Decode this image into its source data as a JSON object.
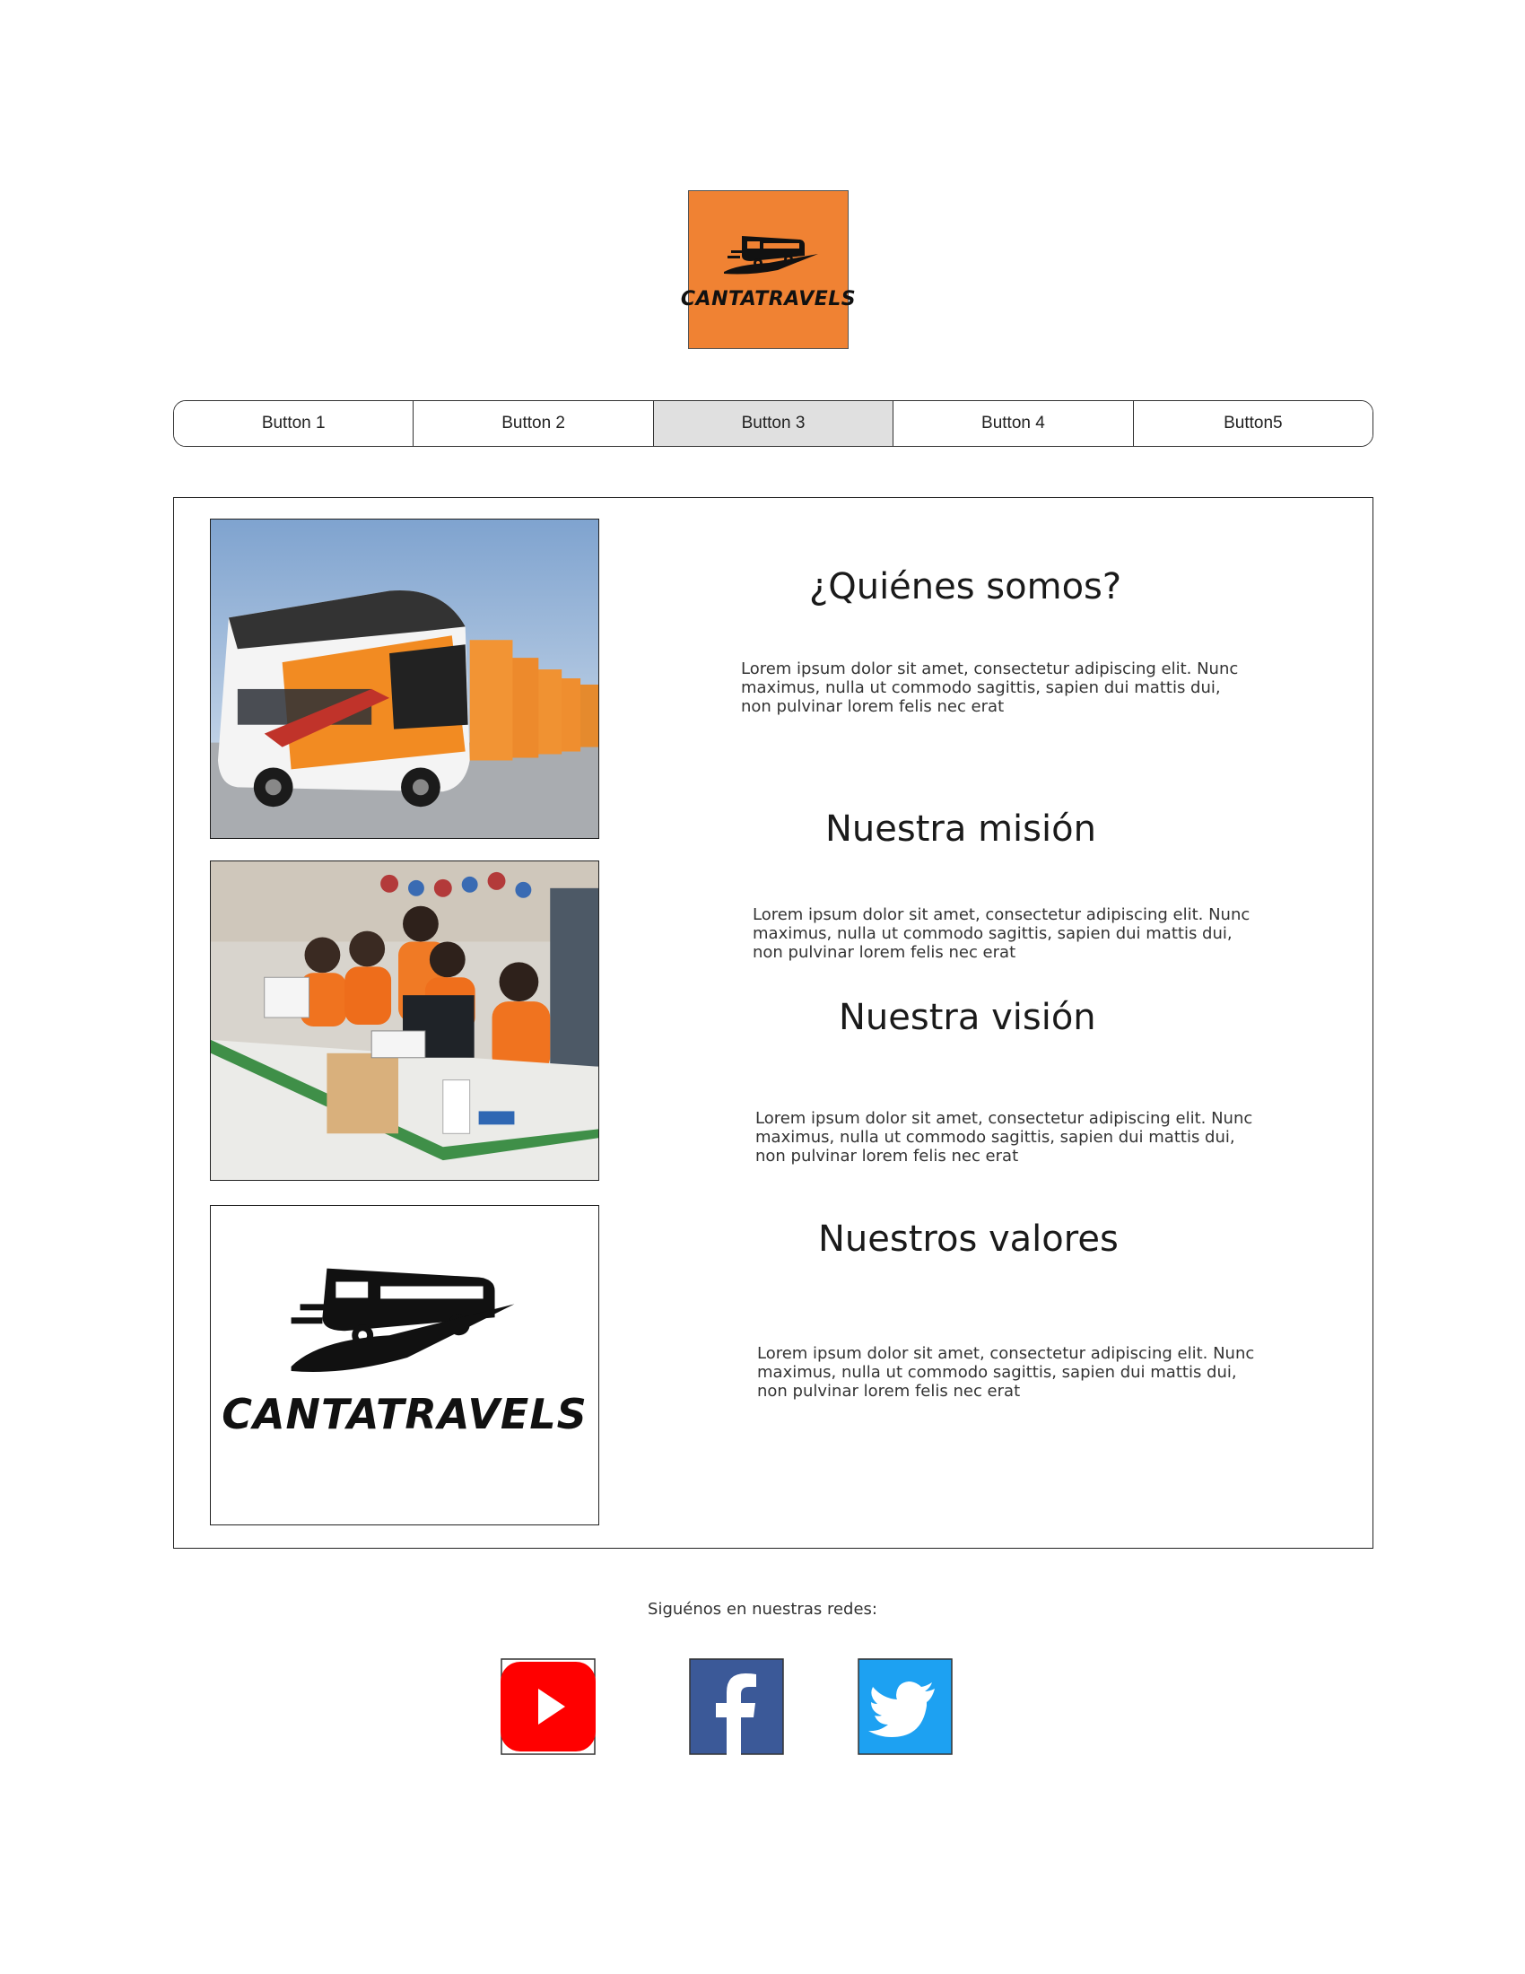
{
  "logo": {
    "text": "CANTATRAVELS",
    "background": "#f08233",
    "icon": "bus-icon"
  },
  "nav": {
    "buttons": [
      {
        "label": "Button 1"
      },
      {
        "label": "Button 2"
      },
      {
        "label": "Button 3",
        "active": true
      },
      {
        "label": "Button 4"
      },
      {
        "label": "Button5"
      }
    ]
  },
  "sections": [
    {
      "heading": "¿Quiénes somos?",
      "text": "Lorem ipsum dolor sit amet, consectetur adipiscing elit. Nunc maximus, nulla ut commodo sagittis, sapien dui mattis dui, non pulvinar lorem felis nec erat"
    },
    {
      "heading": "Nuestra misión",
      "text": "Lorem ipsum dolor sit amet, consectetur adipiscing elit. Nunc maximus, nulla ut commodo sagittis, sapien dui mattis dui, non pulvinar lorem felis nec erat"
    },
    {
      "heading": "Nuestra visión",
      "text": "Lorem ipsum dolor sit amet, consectetur adipiscing elit. Nunc maximus, nulla ut commodo sagittis, sapien dui mattis dui, non pulvinar lorem felis nec erat"
    },
    {
      "heading": "Nuestros valores",
      "text": "Lorem ipsum dolor sit amet, consectetur adipiscing elit. Nunc maximus, nulla ut commodo sagittis, sapien dui mattis dui, non pulvinar lorem felis nec erat"
    }
  ],
  "images": {
    "bus_fleet": "bus-fleet-photo",
    "office_staff": "office-staff-photo",
    "logo_large_text": "CANTATRAVELS"
  },
  "footer": {
    "follow_text": "Siguénos en nuestras redes:",
    "social": [
      {
        "name": "youtube-icon",
        "color": "#ff0000"
      },
      {
        "name": "facebook-icon",
        "color": "#3b5998"
      },
      {
        "name": "twitter-icon",
        "color": "#1da1f2"
      }
    ]
  }
}
